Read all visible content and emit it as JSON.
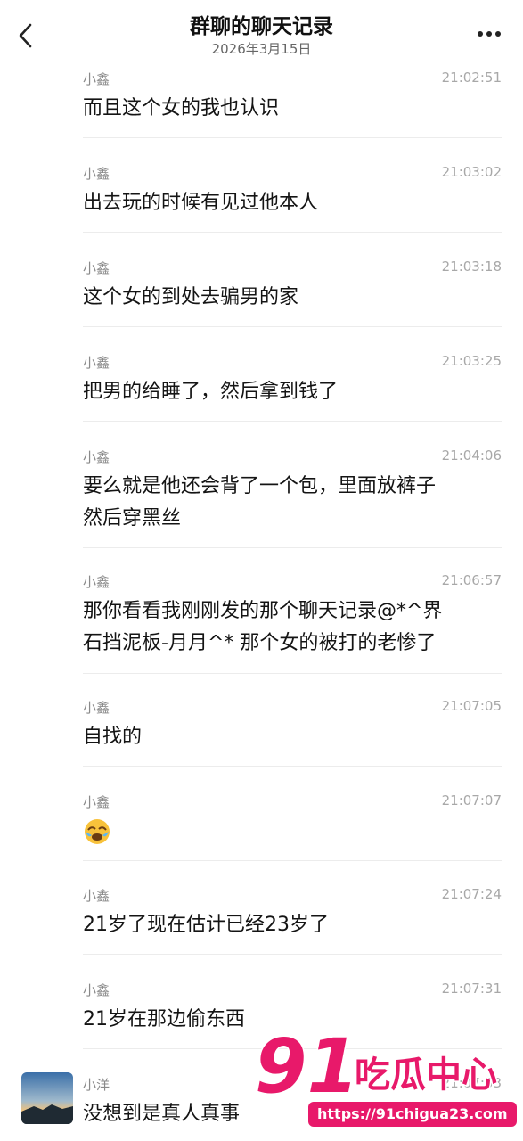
{
  "header": {
    "title": "群聊的聊天记录",
    "date": "2026年3月15日"
  },
  "messages": [
    {
      "sender": "小鑫",
      "time": "21:02:51",
      "lines": [
        "而且这个女的我也认识"
      ]
    },
    {
      "sender": "小鑫",
      "time": "21:03:02",
      "lines": [
        "出去玩的时候有见过他本人"
      ]
    },
    {
      "sender": "小鑫",
      "time": "21:03:18",
      "lines": [
        "这个女的到处去骗男的家"
      ]
    },
    {
      "sender": "小鑫",
      "time": "21:03:25",
      "lines": [
        "把男的给睡了，然后拿到钱了"
      ]
    },
    {
      "sender": "小鑫",
      "time": "21:04:06",
      "lines": [
        "要么就是他还会背了一个包，里面放裤子",
        "然后穿黑丝"
      ]
    },
    {
      "sender": "小鑫",
      "time": "21:06:57",
      "lines": [
        "那你看看我刚刚发的那个聊天记录@*^界",
        "石挡泥板-月月^* 那个女的被打的老惨了"
      ]
    },
    {
      "sender": "小鑫",
      "time": "21:07:05",
      "lines": [
        "自找的"
      ]
    },
    {
      "sender": "小鑫",
      "time": "21:07:07",
      "emoji": "sob-emoji"
    },
    {
      "sender": "小鑫",
      "time": "21:07:24",
      "lines": [
        "21岁了现在估计已经23岁了"
      ]
    },
    {
      "sender": "小鑫",
      "time": "21:07:31",
      "lines": [
        "21岁在那边偷东西"
      ]
    },
    {
      "sender": "小洋",
      "time": "21:07:33",
      "lines": [
        "没想到是真人真事"
      ]
    }
  ],
  "watermark": {
    "number": "91",
    "brand": "吃瓜中心",
    "url": "https://91chigua23.com",
    "color": "#e8196a"
  },
  "icons": {
    "back": "chevron-left-icon",
    "more": "more-dots-icon"
  }
}
